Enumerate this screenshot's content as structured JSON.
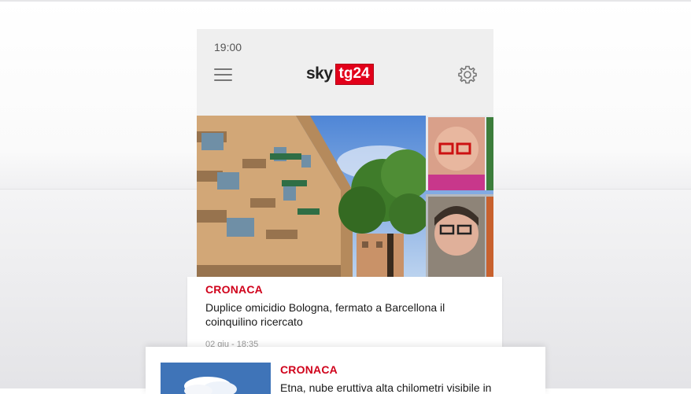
{
  "status": {
    "time": "19:00"
  },
  "appbar": {
    "logo_sky": "sky",
    "logo_tg": "tg24"
  },
  "icons": {
    "menu": "hamburger-menu-icon",
    "settings": "gear-icon"
  },
  "colors": {
    "accent": "#e2001a",
    "category": "#d0021b",
    "background": "#efefef"
  },
  "articles": [
    {
      "category": "CRONACA",
      "headline": "Duplice omicidio Bologna, fermato a Barcellona il coinquilino ricercato",
      "date": "02 giu - 18:35"
    },
    {
      "category": "CRONACA",
      "headline": "Etna, nube eruttiva alta chilometri visibile in"
    }
  ]
}
